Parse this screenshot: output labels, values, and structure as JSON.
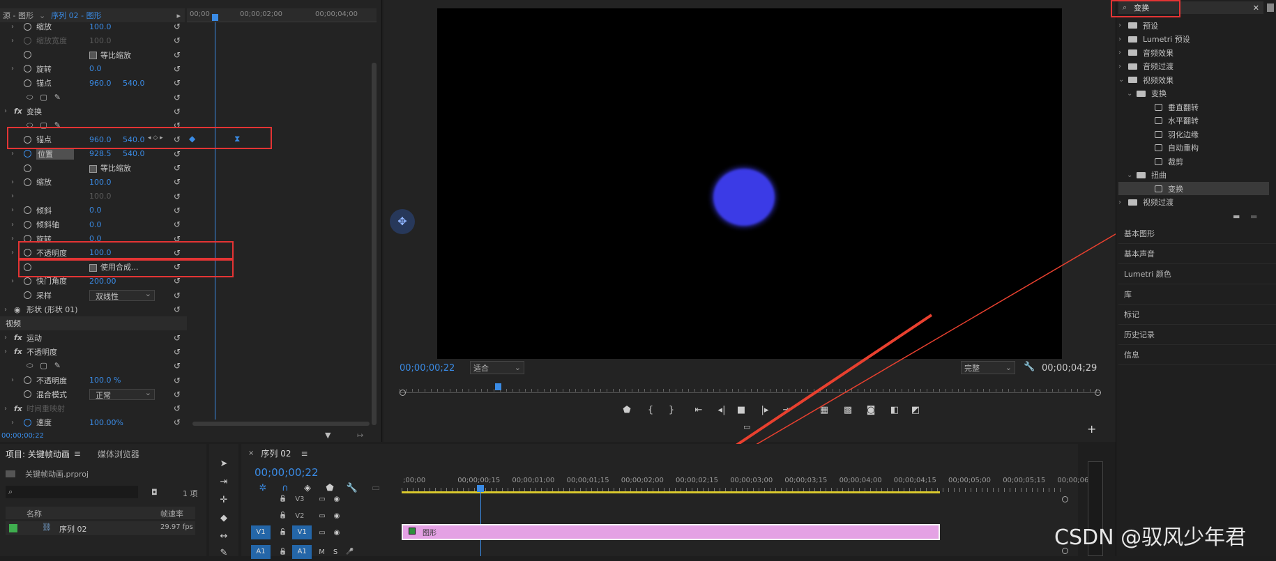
{
  "effect_controls": {
    "tab_source": "源 - 图形",
    "tab_sequence": "序列 02 - 图形",
    "ruler_times": [
      "00;00",
      "00;00;02;00",
      "00;00;04;00"
    ],
    "rows": [
      {
        "label": "缩放",
        "v1": "100.0",
        "chev": true,
        "dim": false
      },
      {
        "label": "缩放宽度",
        "v1": "100.0",
        "chev": true,
        "dim": true
      },
      {
        "label": "",
        "check": "等比缩放"
      },
      {
        "label": "旋转",
        "v1": "0.0",
        "chev": true
      },
      {
        "label": "锚点",
        "v1": "960.0",
        "v2": "540.0"
      },
      {
        "label": "",
        "v1": ""
      },
      {
        "label": "变换",
        "fx": true
      },
      {
        "label": "",
        "v1": ""
      },
      {
        "label": "锚点",
        "v1": "960.0",
        "v2": "540.0"
      },
      {
        "label": "位置",
        "v1": "928.5",
        "v2": "540.0",
        "chev": true
      },
      {
        "label": "",
        "check": "等比缩放"
      },
      {
        "label": "缩放",
        "v1": "100.0",
        "chev": true
      },
      {
        "label": "",
        "v1": "100.0",
        "chev": true,
        "dim": true
      },
      {
        "label": "倾斜",
        "v1": "0.0",
        "chev": true
      },
      {
        "label": "倾斜轴",
        "v1": "0.0",
        "chev": true
      },
      {
        "label": "旋转",
        "v1": "0.0",
        "chev": true
      },
      {
        "label": "不透明度",
        "v1": "100.0",
        "chev": true
      },
      {
        "label": "",
        "check": "使用合成..."
      },
      {
        "label": "快门角度",
        "v1": "200.00",
        "chev": true
      },
      {
        "label": "采样",
        "select": "双线性"
      },
      {
        "label": "形状 (形状 01)",
        "eye": true
      },
      {
        "label": "视频",
        "section": true
      },
      {
        "label": "运动",
        "fx": true
      },
      {
        "label": "不透明度",
        "fx": true
      },
      {
        "label": "",
        "v1": ""
      },
      {
        "label": "不透明度",
        "v1": "100.0 %",
        "chev": true
      },
      {
        "label": "混合模式",
        "select": "正常"
      },
      {
        "label": "时间重映射",
        "fx": true,
        "dim": true
      },
      {
        "label": "速度",
        "v1": "100.00%",
        "chev": true
      }
    ],
    "timecode": "00;00;00;22"
  },
  "program_monitor": {
    "timecode_current": "00;00;00;22",
    "fit_select": "适合",
    "quality_select": "完整",
    "timecode_duration": "00;00;04;29",
    "circle_color": "#3b3be6"
  },
  "effects_panel": {
    "search_value": "变换",
    "tree": [
      {
        "label": "预设",
        "level": 0,
        "icon": "folder-star"
      },
      {
        "label": "Lumetri 预设",
        "level": 0,
        "icon": "folder-star"
      },
      {
        "label": "音频效果",
        "level": 0,
        "icon": "folder"
      },
      {
        "label": "音频过渡",
        "level": 0,
        "icon": "folder"
      },
      {
        "label": "视频效果",
        "level": 0,
        "icon": "folder",
        "open": true
      },
      {
        "label": "变换",
        "level": 1,
        "icon": "folder",
        "open": true
      },
      {
        "label": "垂直翻转",
        "level": 2,
        "icon": "fx"
      },
      {
        "label": "水平翻转",
        "level": 2,
        "icon": "fx"
      },
      {
        "label": "羽化边缘",
        "level": 2,
        "icon": "fx"
      },
      {
        "label": "自动重构",
        "level": 2,
        "icon": "fx"
      },
      {
        "label": "裁剪",
        "level": 2,
        "icon": "fx"
      },
      {
        "label": "扭曲",
        "level": 1,
        "icon": "folder",
        "open": true
      },
      {
        "label": "变换",
        "level": 2,
        "icon": "fx",
        "selected": true
      },
      {
        "label": "视频过渡",
        "level": 0,
        "icon": "folder"
      }
    ],
    "panels": [
      "基本图形",
      "基本声音",
      "Lumetri 颜色",
      "库",
      "标记",
      "历史记录",
      "信息"
    ]
  },
  "project": {
    "tab_project": "项目: 关键帧动画",
    "tab_media": "媒体浏览器",
    "file": "关键帧动画.prproj",
    "count": "1 项",
    "col_name": "名称",
    "col_rate": "帧速率",
    "item_name": "序列 02",
    "item_rate": "29.97 fps"
  },
  "timeline": {
    "tab": "序列 02",
    "timecode": "00;00;00;22",
    "ruler": [
      ";00;00",
      "00;00;00;15",
      "00;00;01;00",
      "00;00;01;15",
      "00;00;02;00",
      "00;00;02;15",
      "00;00;03;00",
      "00;00;03;15",
      "00;00;04;00",
      "00;00;04;15",
      "00;00;05;00",
      "00;00;05;15",
      "00;00;06"
    ],
    "tracks": [
      "V3",
      "V2",
      "V1",
      "A1"
    ],
    "clip_label": "图形"
  },
  "watermark": "CSDN @驭风少年君"
}
